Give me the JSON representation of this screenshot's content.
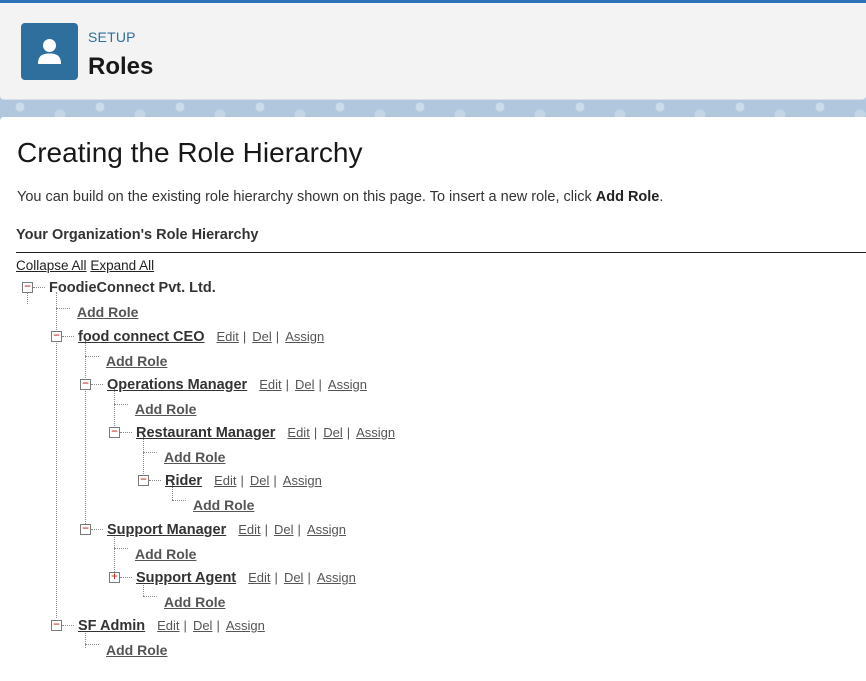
{
  "header": {
    "section_label": "SETUP",
    "title": "Roles",
    "icon": "user-icon"
  },
  "main": {
    "heading": "Creating the Role Hierarchy",
    "intro_text": "You can build on the existing role hierarchy shown on this page. To insert a new role, click ",
    "intro_bold": "Add Role",
    "intro_end": ".",
    "section_title": "Your Organization's Role Hierarchy",
    "collapse_all": "Collapse All",
    "expand_all": "Expand All",
    "add_role_label": "Add Role",
    "edit_label": "Edit",
    "del_label": "Del",
    "assign_label": "Assign",
    "sep": "|",
    "root": "FoodieConnect Pvt. Ltd.",
    "roles": {
      "ceo": "food connect CEO",
      "ops": "Operations Manager",
      "restaurant": "Restaurant Manager",
      "rider": "Rider",
      "support": "Support Manager",
      "agent": "Support Agent",
      "admin": "SF Admin"
    }
  },
  "colors": {
    "brand_blue": "#2e6f9e",
    "toggle_minus": "#c0392b"
  }
}
